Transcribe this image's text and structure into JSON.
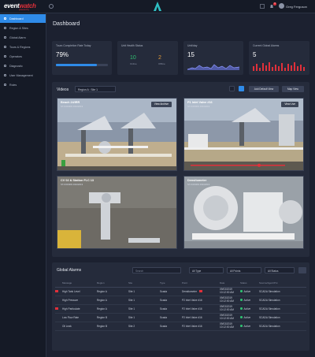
{
  "app": {
    "logo_main": "event",
    "logo_accent": "watch",
    "logo_sub": "powered by",
    "user_name": "Greg Ferguson",
    "notification_count": "3"
  },
  "sidebar": {
    "items": [
      {
        "label": "Dashboard",
        "active": true
      },
      {
        "label": "Region & Sites"
      },
      {
        "label": "Global Alarm"
      },
      {
        "label": "Tours & Regions"
      },
      {
        "label": "Operators"
      },
      {
        "label": "Diagnostic"
      },
      {
        "label": "User Management"
      },
      {
        "label": "Roles"
      }
    ]
  },
  "page": {
    "title": "Dashboard"
  },
  "kpis": [
    {
      "label": "Tours Completion Rate Today",
      "value": "79%"
    },
    {
      "label": "Unit Health Status",
      "value_a": "10",
      "sub_a": "Online",
      "value_b": "2",
      "sub_b": "Offline"
    },
    {
      "label": "Unit/day",
      "value": "15"
    },
    {
      "label": "Current Global Alarms",
      "value": "5"
    }
  ],
  "kpi_colors": {
    "online": "#2fbf71",
    "offline": "#e09a3a",
    "sparkline": "#6f7cf0",
    "bars": "#e0303a"
  },
  "videos": {
    "title": "Videos",
    "region_select": "Region A : Site 1",
    "add_button": "Add Default View",
    "map_button": "Map View",
    "cameras": [
      {
        "name": "Beach 24/IRR",
        "sub": "ST-K003RN  03102019",
        "button": "View Archive"
      },
      {
        "name": "P1 Inlet Valve #16",
        "sub": "ST-K003RN  03102019",
        "button": "View Live"
      },
      {
        "name": "CV 02 & Station FLC 13",
        "sub": "ST-K003RN  03102019",
        "button": ""
      },
      {
        "name": "Densitometer",
        "sub": "ST-K003RN  03102019",
        "button": ""
      }
    ]
  },
  "alarms": {
    "title": "Global Alarms",
    "search_placeholder": "Search",
    "filters": [
      "All Type",
      "All Points",
      "All Status"
    ],
    "columns": [
      "Message",
      "Region",
      "Site",
      "Type",
      "Point",
      "Date",
      "Status",
      "Source/Agent/Pnt"
    ],
    "rows": [
      {
        "flag": true,
        "message": "High Tank Level",
        "region": "Region A",
        "site": "Site 1",
        "type": "Scada",
        "point": "Densitometer",
        "date": "09/03/2019",
        "time": "10:12:00 AM",
        "status": "Active",
        "source": "SCADA Simulation"
      },
      {
        "flag": false,
        "message": "High Pressure",
        "region": "Region A",
        "site": "Site 1",
        "type": "Scada",
        "point": "P2 Inlet Valve #16",
        "date": "09/03/2019",
        "time": "10:12:00 AM",
        "status": "Active",
        "source": "SCADA Simulation"
      },
      {
        "flag": true,
        "message": "High Particulate",
        "region": "Region A",
        "site": "Site 1",
        "type": "Scada",
        "point": "P2 Inlet Valve #16",
        "date": "09/03/2019",
        "time": "10:12:00 AM",
        "status": "Active",
        "source": "SCADA Simulation"
      },
      {
        "flag": false,
        "message": "Low Flow Rate",
        "region": "Region B",
        "site": "Site 1",
        "type": "Scada",
        "point": "P2 Inlet Valve #16",
        "date": "09/03/2019",
        "time": "10:12:00 AM",
        "status": "Active",
        "source": "SCADA Simulation"
      },
      {
        "flag": false,
        "message": "Oil Leak",
        "region": "Region B",
        "site": "Site 2",
        "type": "Scada",
        "point": "P2 Inlet Valve #16",
        "date": "09/03/2019",
        "time": "10:12:00 AM",
        "status": "Active",
        "source": "SCADA Simulation"
      }
    ]
  },
  "colors": {
    "accent": "#2f8be8",
    "background": "#1c2130",
    "panel": "#252b3b",
    "alarm_flag": "#e0303a",
    "status_active": "#2fbf71"
  }
}
